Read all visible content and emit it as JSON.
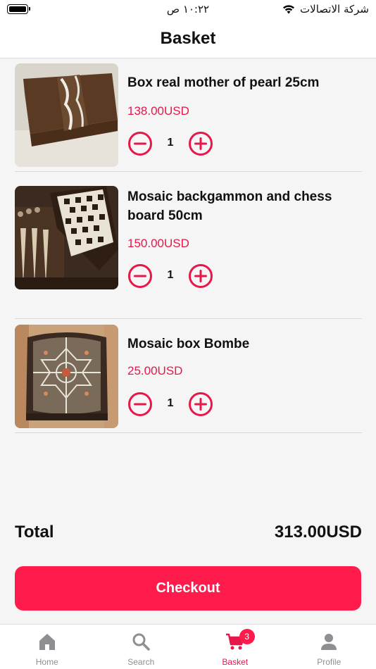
{
  "status_bar": {
    "time": "١٠:٢٢ ص",
    "carrier": "شركة الاتصالات"
  },
  "header": {
    "title": "Basket"
  },
  "items": [
    {
      "name": "Box real mother of pearl 25cm",
      "price": "138.00USD",
      "quantity": "1"
    },
    {
      "name": "Mosaic backgammon and chess board 50cm",
      "price": "150.00USD",
      "quantity": "1"
    },
    {
      "name": "Mosaic box Bombe",
      "price": "25.00USD",
      "quantity": "1"
    }
  ],
  "total": {
    "label": "Total",
    "value": "313.00USD"
  },
  "checkout": {
    "label": "Checkout"
  },
  "tabbar": {
    "tabs": [
      {
        "label": "Home",
        "icon": "home-icon"
      },
      {
        "label": "Search",
        "icon": "search-icon"
      },
      {
        "label": "Basket",
        "icon": "cart-icon",
        "badge": "3",
        "active": true
      },
      {
        "label": "Profile",
        "icon": "profile-icon"
      }
    ]
  },
  "colors": {
    "accent": "#ff1c4d",
    "price": "#e8174a",
    "inactive_tab": "#8e8e93"
  }
}
